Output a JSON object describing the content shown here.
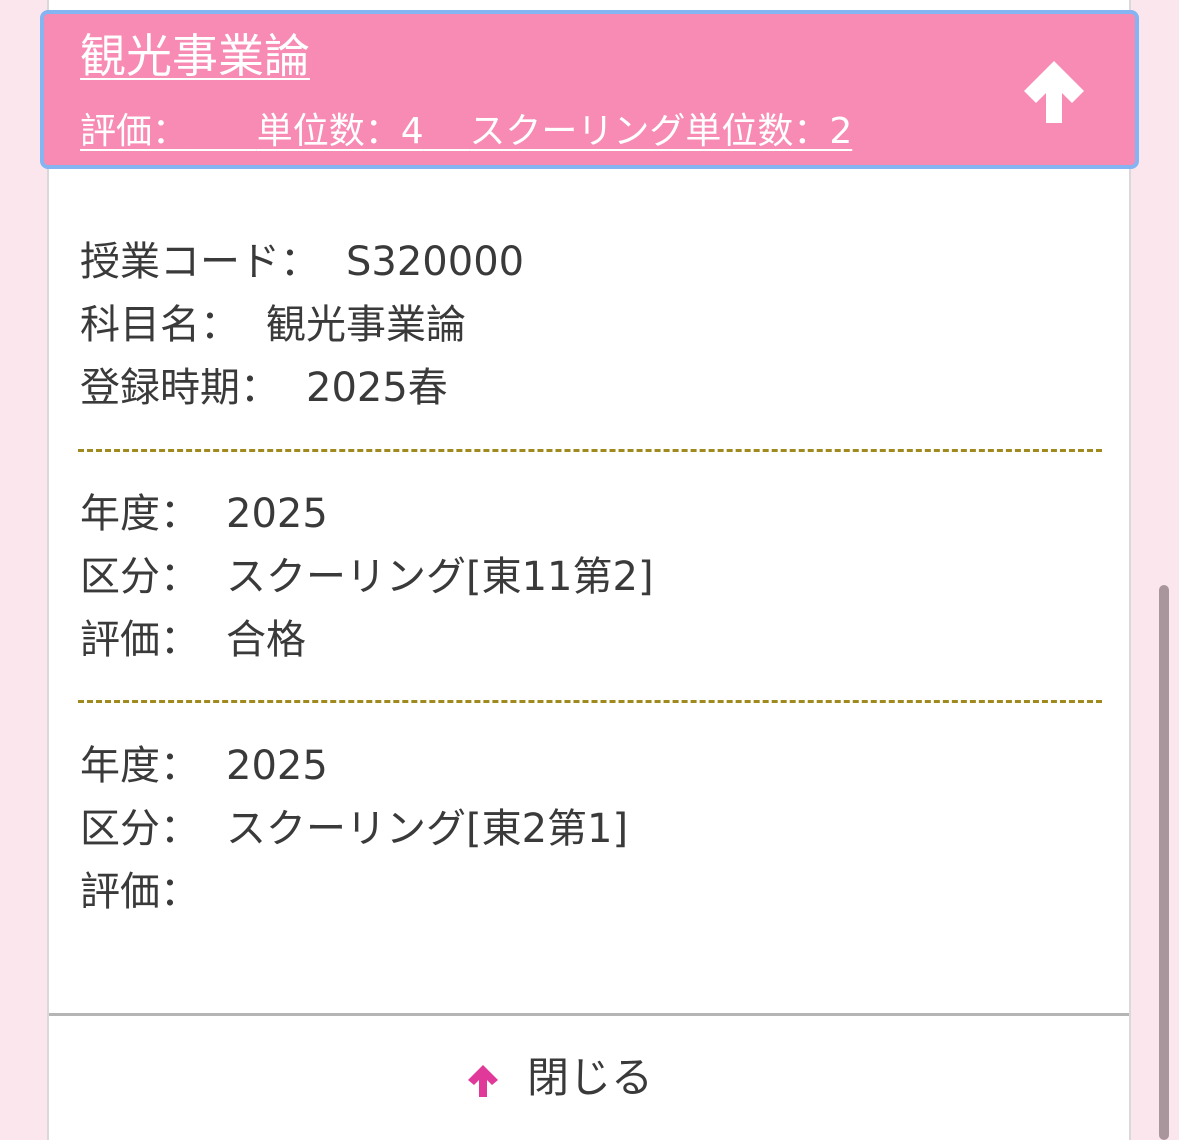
{
  "header": {
    "title": "観光事業論",
    "evaluation_label": "評価：",
    "units_label": "単位数：4",
    "schooling_units_label": "スクーリング単位数：2",
    "expand_state_icon": "arrow-up-icon"
  },
  "course_info": {
    "code_label": "授業コード：",
    "code_value": "S320000",
    "name_label": "科目名：",
    "name_value": "観光事業論",
    "period_label": "登録時期：",
    "period_value": "2025春"
  },
  "records": [
    {
      "year_label": "年度：",
      "year_value": "2025",
      "category_label": "区分：",
      "category_value": "スクーリング[東11第2]",
      "evaluation_label": "評価：",
      "evaluation_value": "合格"
    },
    {
      "year_label": "年度：",
      "year_value": "2025",
      "category_label": "区分：",
      "category_value": "スクーリング[東2第1]",
      "evaluation_label": "評価：",
      "evaluation_value": ""
    }
  ],
  "footer": {
    "close_label": "閉じる",
    "close_icon": "arrow-up-icon"
  },
  "colors": {
    "header_bg": "#f78bb3",
    "header_focus_border": "#84b4f2",
    "page_bg": "#fce6ee",
    "divider": "#a08a1e",
    "close_arrow": "#e0399a"
  }
}
